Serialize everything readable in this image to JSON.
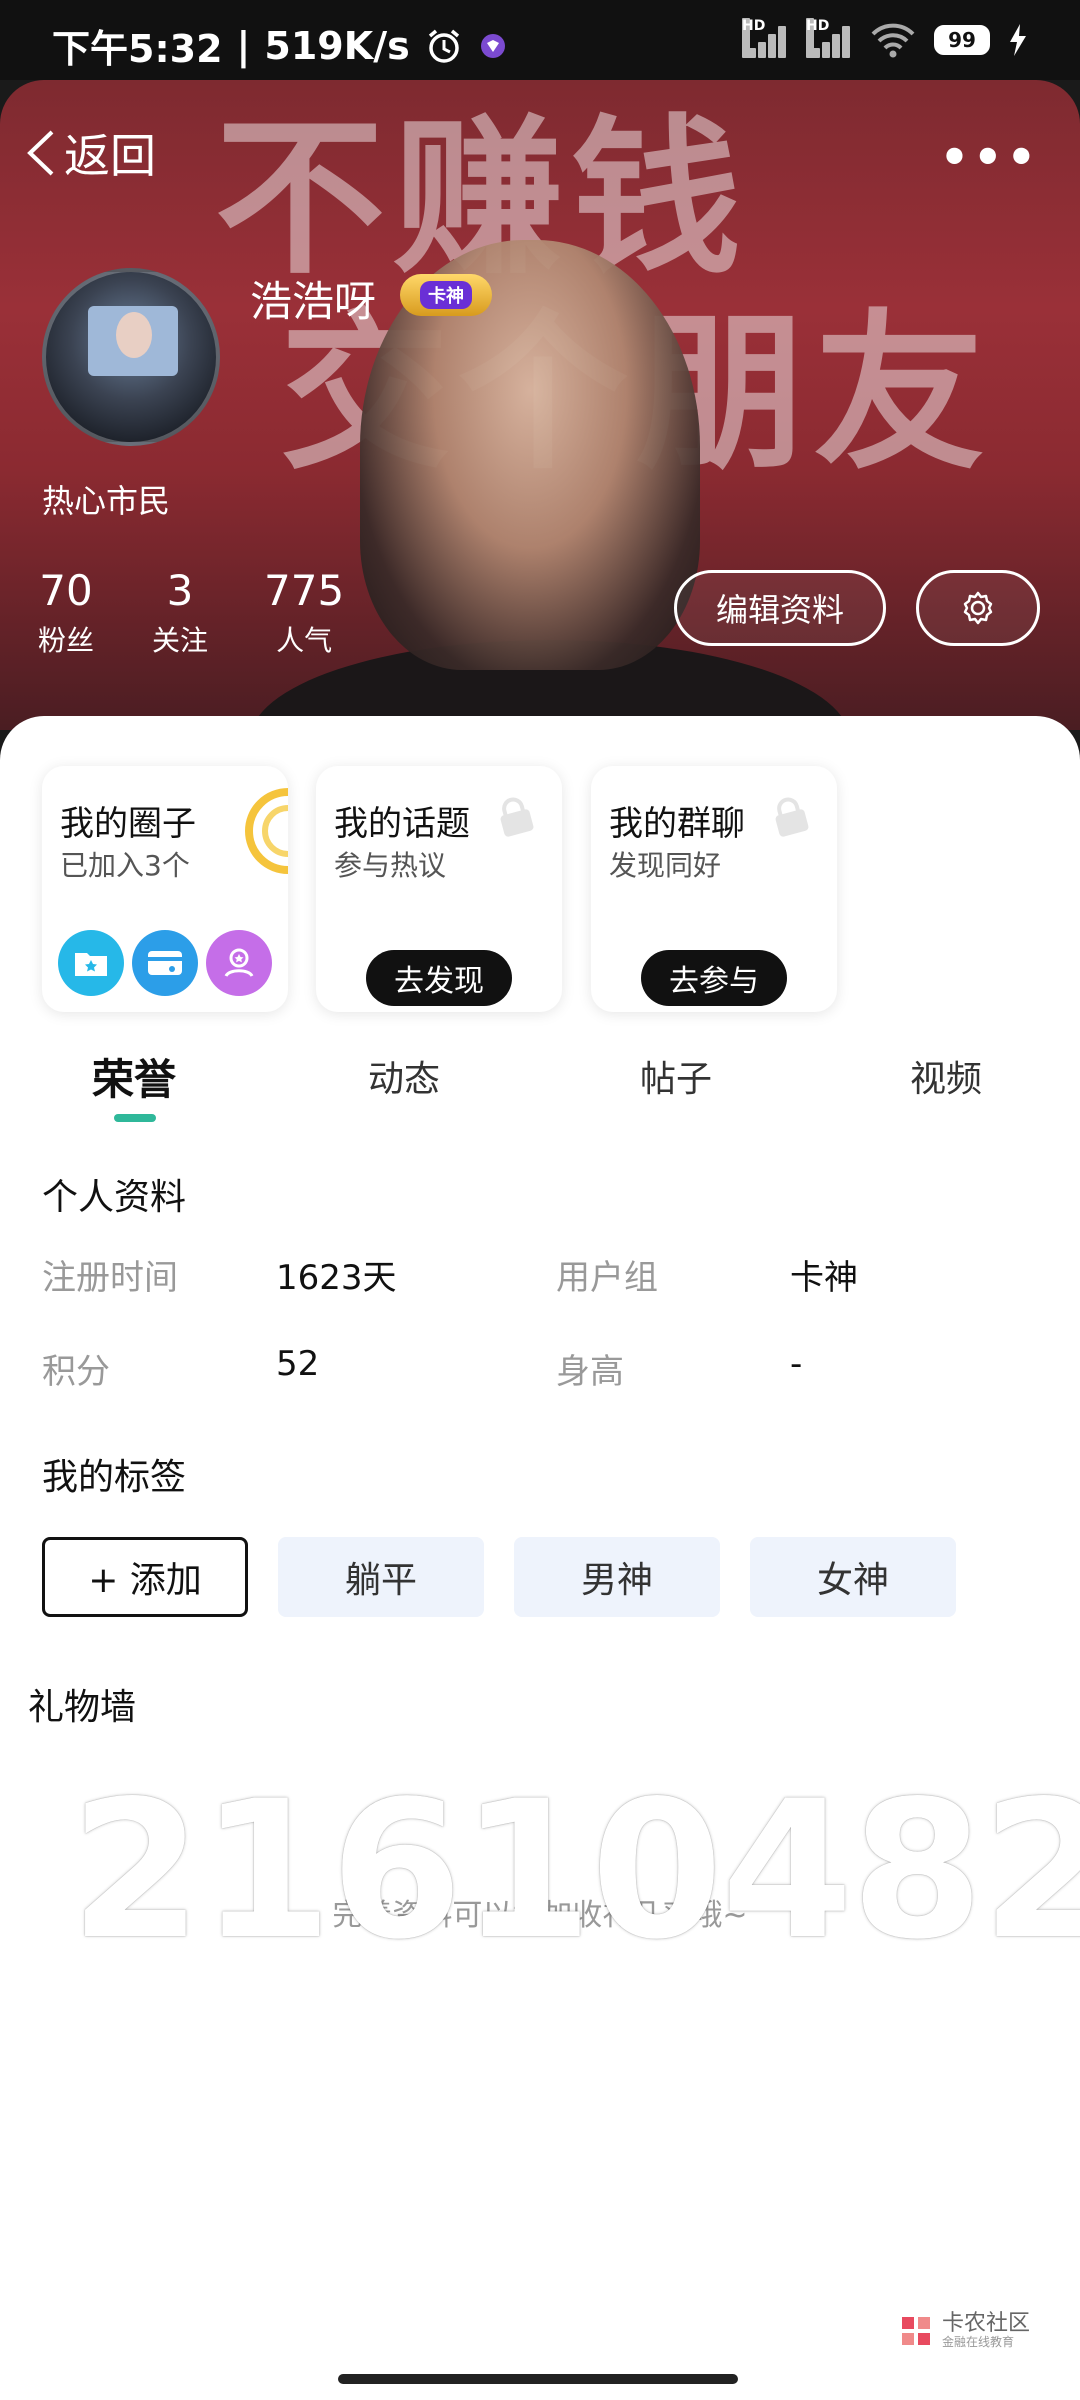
{
  "status_bar": {
    "time": "下午5:32",
    "speed": "519K/s",
    "battery": "99",
    "hd1": "HD",
    "hd2": "HD"
  },
  "header": {
    "back_label": "返回",
    "more_label": "•••",
    "background_text_line1": "不赚钱",
    "background_text_line2": "交个朋友",
    "username": "浩浩呀",
    "badge": "卡神",
    "user_title": "热心市民",
    "stats": [
      {
        "value": "70",
        "label": "粉丝"
      },
      {
        "value": "3",
        "label": "关注"
      },
      {
        "value": "775",
        "label": "人气"
      }
    ],
    "edit_label": "编辑资料"
  },
  "cards": [
    {
      "title": "我的圈子",
      "subtitle": "已加入3个"
    },
    {
      "title": "我的话题",
      "subtitle": "参与热议",
      "button": "去发现"
    },
    {
      "title": "我的群聊",
      "subtitle": "发现同好",
      "button": "去参与"
    }
  ],
  "tabs": [
    "荣誉",
    "动态",
    "帖子",
    "视频"
  ],
  "profile": {
    "title": "个人资料",
    "rows": [
      {
        "label": "注册时间",
        "value": "1623天",
        "label2": "用户组",
        "value2": "卡神"
      },
      {
        "label": "积分",
        "value": "52",
        "label2": "身高",
        "value2": "-"
      }
    ]
  },
  "tags": {
    "title": "我的标签",
    "add_label": "+ 添加",
    "items": [
      "躺平",
      "男神",
      "女神"
    ]
  },
  "gift_wall": {
    "title": "礼物墙",
    "hint": "完善资料可以增加收礼几率哦~",
    "watermark": "21610482"
  },
  "logo": {
    "name": "卡农社区",
    "sub": "金融在线教育"
  },
  "colors": {
    "tab_indicator": "#2fb89a",
    "header_bg": "#8b2a31",
    "chip_bg": "#eef3fc"
  }
}
